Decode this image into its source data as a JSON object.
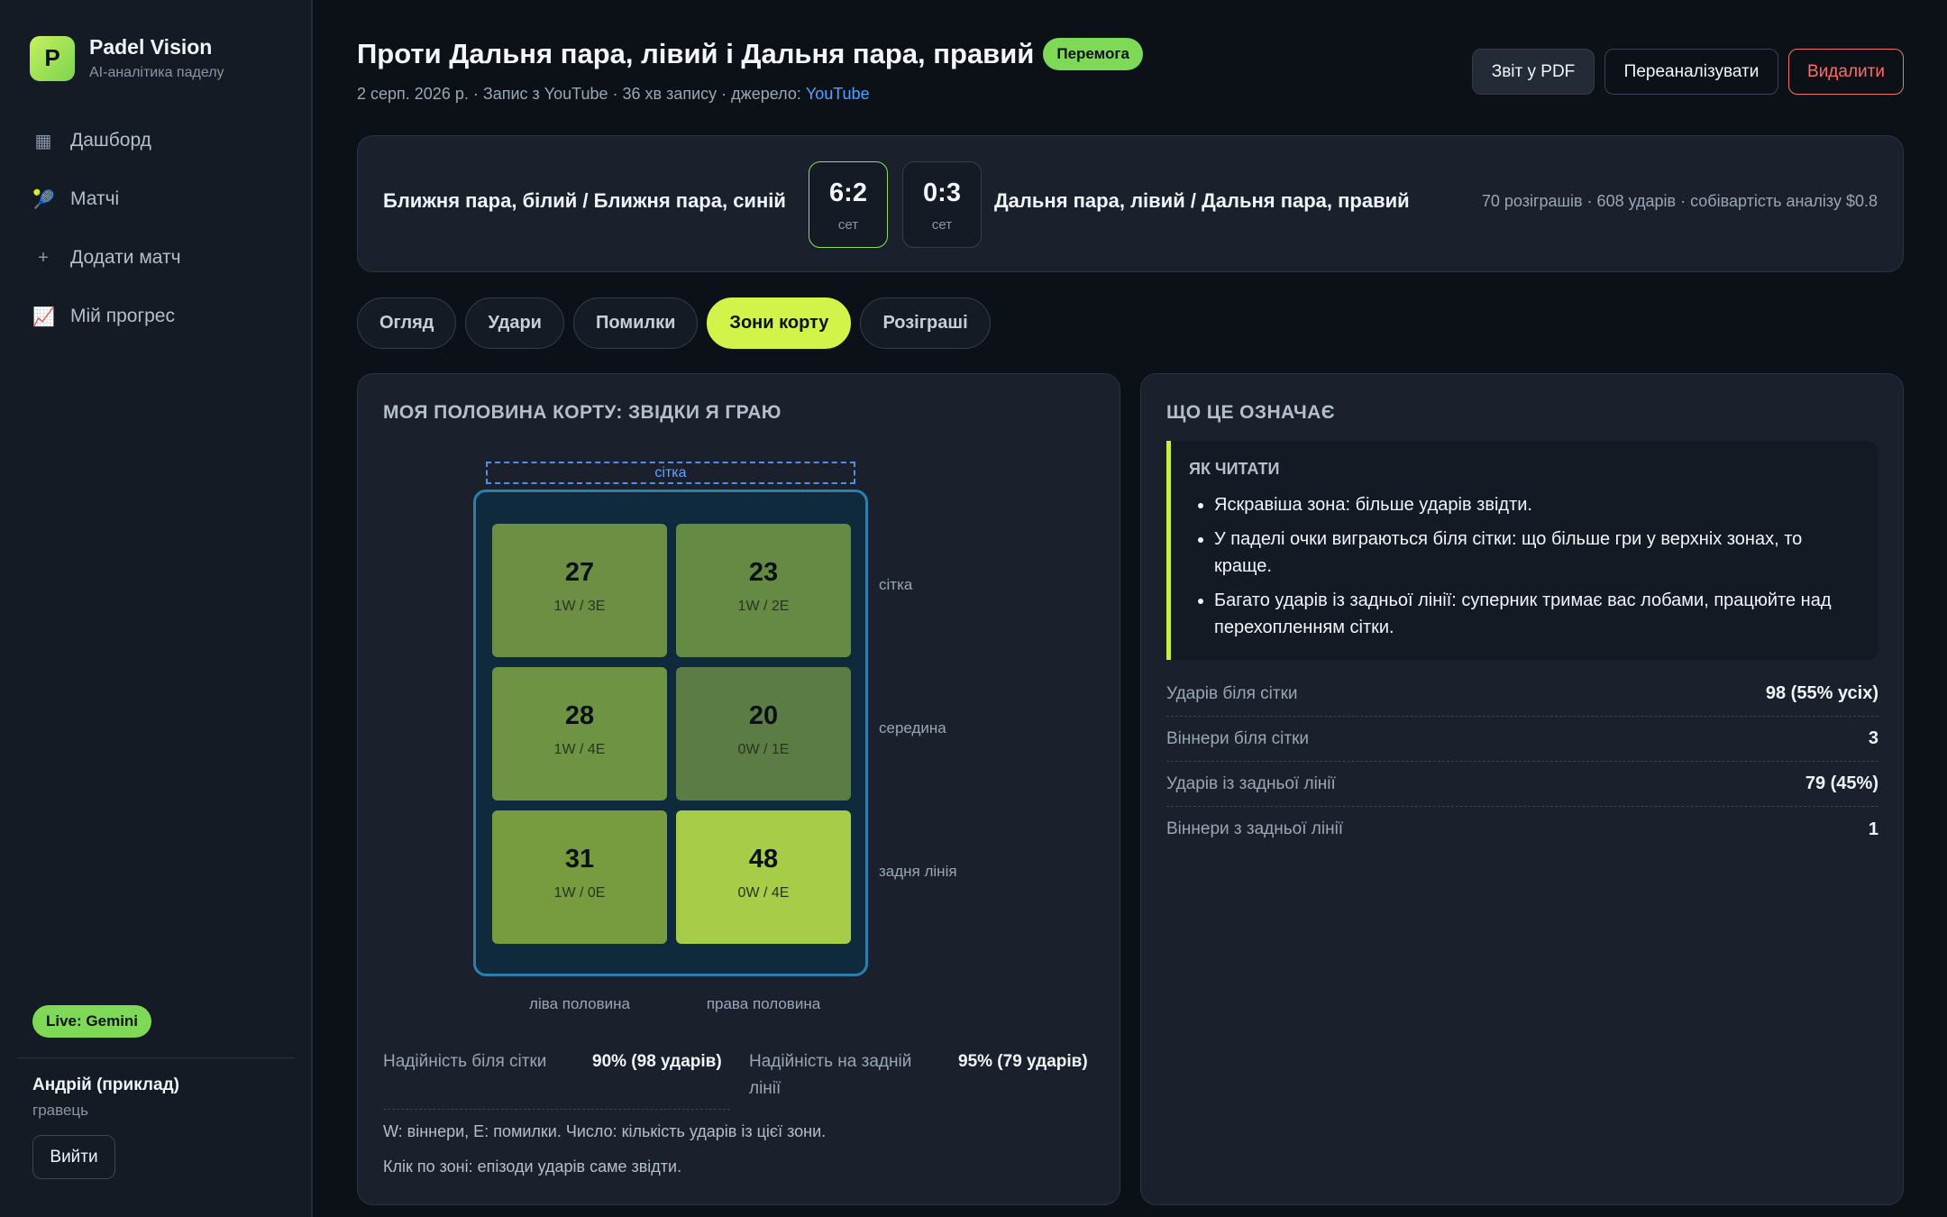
{
  "app": {
    "logo_letter": "P",
    "name": "Padel Vision",
    "subtitle": "AI-аналітика паделу"
  },
  "nav": [
    {
      "label": "Дашборд",
      "icon": "dashboard-icon",
      "glyph": "▦"
    },
    {
      "label": "Матчі",
      "icon": "racket-icon",
      "glyph": "🎾"
    },
    {
      "label": "Додати матч",
      "icon": "plus-icon",
      "glyph": "+"
    },
    {
      "label": "Мій прогрес",
      "icon": "chart-icon",
      "glyph": "📈"
    }
  ],
  "live_badge": "Live: Gemini",
  "user": {
    "name": "Андрій (приклад)",
    "role": "гравець",
    "logout": "Вийти"
  },
  "header": {
    "title": "Проти Дальня пара, лівий і Дальня пара, правий",
    "result_badge": "Перемога",
    "meta": "2 серп. 2026 р. · Запис з YouTube · 36 хв запису · джерело: ",
    "source_link": "YouTube",
    "buttons": {
      "pdf": "Звіт у PDF",
      "reanalyze": "Переаналізувати",
      "delete": "Видалити"
    }
  },
  "score": {
    "team_a": "Ближня пара, білий / Ближня пара, синій",
    "team_b": "Дальня пара, лівий / Дальня пара, правий",
    "sets": [
      {
        "score": "6:2",
        "label": "сет",
        "won": true
      },
      {
        "score": "0:3",
        "label": "сет",
        "won": false
      }
    ],
    "stats": "70 розіграшів · 608 ударів · собівартість аналізу $0.8"
  },
  "tabs": [
    {
      "label": "Огляд",
      "active": false
    },
    {
      "label": "Удари",
      "active": false
    },
    {
      "label": "Помилки",
      "active": false
    },
    {
      "label": "Зони корту",
      "active": true
    },
    {
      "label": "Розіграші",
      "active": false
    }
  ],
  "court_panel": {
    "title": "МОЯ ПОЛОВИНА КОРТУ: ЗВІДКИ Я ГРАЮ",
    "net_label": "сітка",
    "row_labels": [
      "сітка",
      "середина",
      "задня лінія"
    ],
    "col_labels": [
      "ліва половина",
      "права половина"
    ],
    "zones": [
      {
        "count": "27",
        "wl": "1W / 3E",
        "color": "#6c8f43"
      },
      {
        "count": "23",
        "wl": "1W / 2E",
        "color": "#658a44"
      },
      {
        "count": "28",
        "wl": "1W / 4E",
        "color": "#6e9343"
      },
      {
        "count": "20",
        "wl": "0W / 1E",
        "color": "#5b7c45"
      },
      {
        "count": "31",
        "wl": "1W / 0E",
        "color": "#779c40"
      },
      {
        "count": "48",
        "wl": "0W / 4E",
        "color": "#a7cd48"
      }
    ],
    "reliability": [
      {
        "label": "Надійність біля сітки",
        "value": "90% (98 ударів)"
      },
      {
        "label": "Надійність на задній лінії",
        "value": "95% (79 ударів)"
      }
    ],
    "notes": [
      "W: віннери, E: помилки. Число: кількість ударів із цієї зони.",
      "Клік по зоні: епізоди ударів саме звідти."
    ]
  },
  "meaning_panel": {
    "title": "ЩО ЦЕ ОЗНАЧАЄ",
    "howto_title": "ЯК ЧИТАТИ",
    "howto_items": [
      "Яскравіша зона: більше ударів звідти.",
      "У паделі очки виграються біля сітки: що більше гри у верхніх зонах, то краще.",
      "Багато ударів із задньої лінії: суперник тримає вас лобами, працюйте над перехопленням сітки."
    ],
    "stats": [
      {
        "label": "Ударів біля сітки",
        "value": "98 (55% усіх)"
      },
      {
        "label": "Віннери біля сітки",
        "value": "3"
      },
      {
        "label": "Ударів із задньої лінії",
        "value": "79 (45%)"
      },
      {
        "label": "Віннери з задньої лінії",
        "value": "1"
      }
    ]
  },
  "colors": {
    "accent": "#d2f349",
    "win": "#7ed957",
    "danger": "#ff6b6b",
    "link": "#4fa3ff",
    "court_border": "#2b7fae"
  }
}
